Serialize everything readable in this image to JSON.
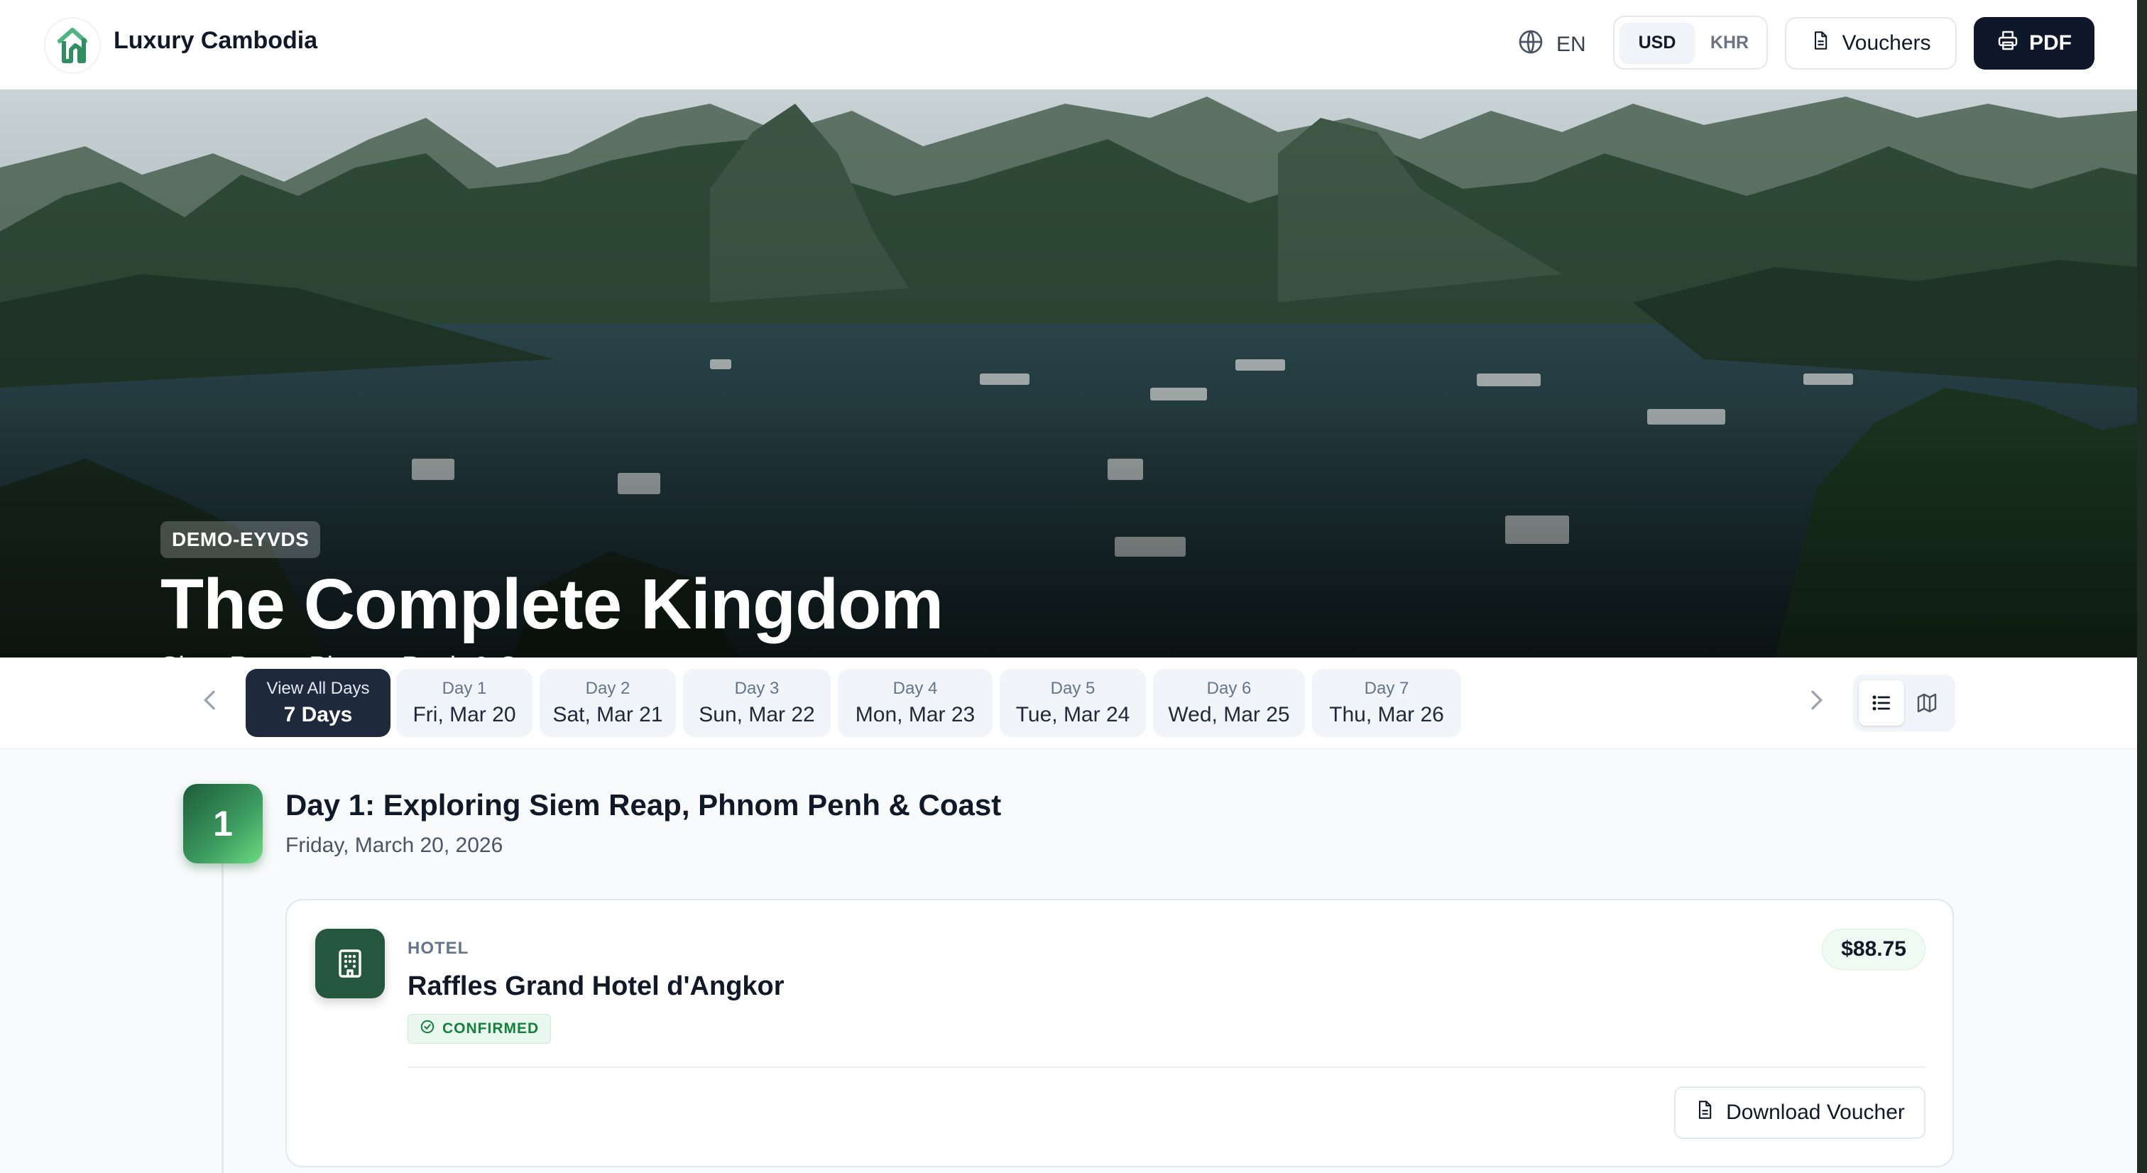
{
  "header": {
    "brand": "Luxury Cambodia",
    "language": "EN",
    "currency": {
      "options": [
        "USD",
        "KHR"
      ],
      "selected": "USD"
    },
    "vouchers_label": "Vouchers",
    "pdf_label": "PDF"
  },
  "hero": {
    "trip_code": "DEMO-EYVDS",
    "title": "The Complete Kingdom",
    "subtitle": "Siem Reap, Phnom Penh & Coast"
  },
  "day_nav": {
    "items": [
      {
        "top": "View All Days",
        "bottom": "7 Days",
        "active": true
      },
      {
        "top": "Day 1",
        "bottom": "Fri, Mar 20"
      },
      {
        "top": "Day 2",
        "bottom": "Sat, Mar 21"
      },
      {
        "top": "Day 3",
        "bottom": "Sun, Mar 22"
      },
      {
        "top": "Day 4",
        "bottom": "Mon, Mar 23"
      },
      {
        "top": "Day 5",
        "bottom": "Tue, Mar 24"
      },
      {
        "top": "Day 6",
        "bottom": "Wed, Mar 25"
      },
      {
        "top": "Day 7",
        "bottom": "Thu, Mar 26"
      }
    ],
    "view_mode": "list"
  },
  "day": {
    "number": "1",
    "title": "Day 1: Exploring Siem Reap, Phnom Penh & Coast",
    "date": "Friday, March 20, 2026"
  },
  "booking": {
    "category": "HOTEL",
    "name": "Raffles Grand Hotel d'Angkor",
    "status": "CONFIRMED",
    "price": "$88.75",
    "download_label": "Download Voucher"
  },
  "colors": {
    "brand_green": "#25573f",
    "accent_green": "#4ade80",
    "dark": "#0f172a",
    "confirmed_green": "#15803d"
  }
}
